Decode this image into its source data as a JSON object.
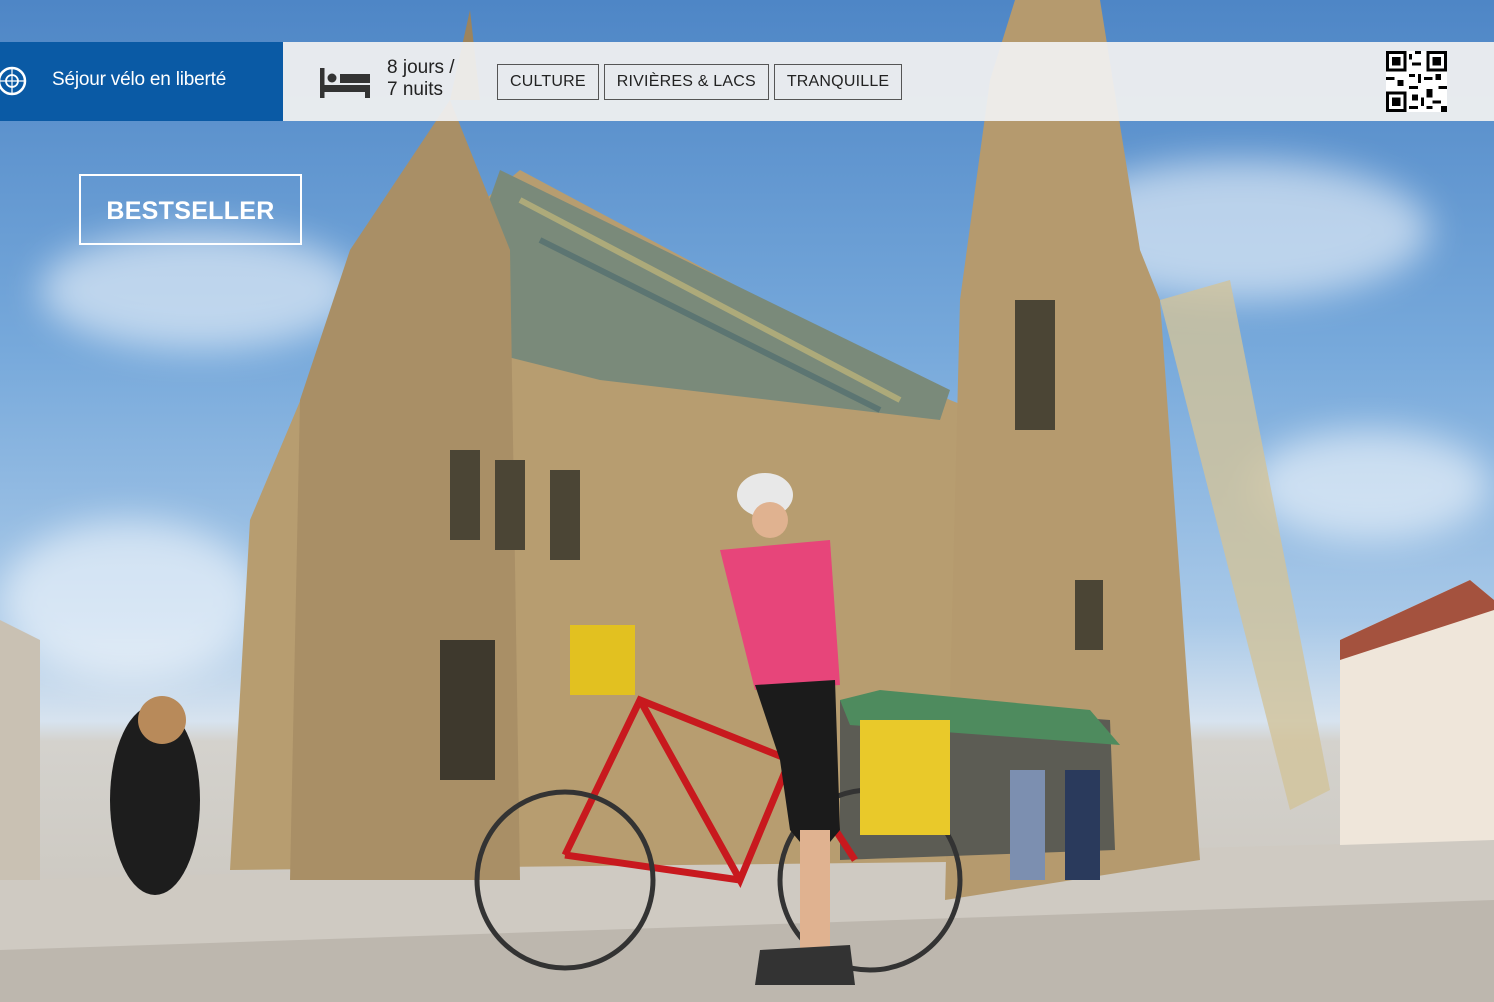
{
  "trip_type": "Séjour vélo en liberté",
  "duration": {
    "line1": "8 jours /",
    "line2": "7 nuits"
  },
  "tags": [
    "CULTURE",
    "RIVIÈRES & LACS",
    "TRANQUILLE"
  ],
  "badge": "BESTSELLER",
  "photo": {
    "subject": "cyclist-with-bicycle-in-front-of-gothic-cathedral"
  },
  "colors": {
    "brand_blue": "#0a5aa5",
    "bar_bg": "#f0f0f0",
    "tag_border": "#555555"
  },
  "icons": [
    "bicycle-icon",
    "bed-icon",
    "qr-code"
  ]
}
